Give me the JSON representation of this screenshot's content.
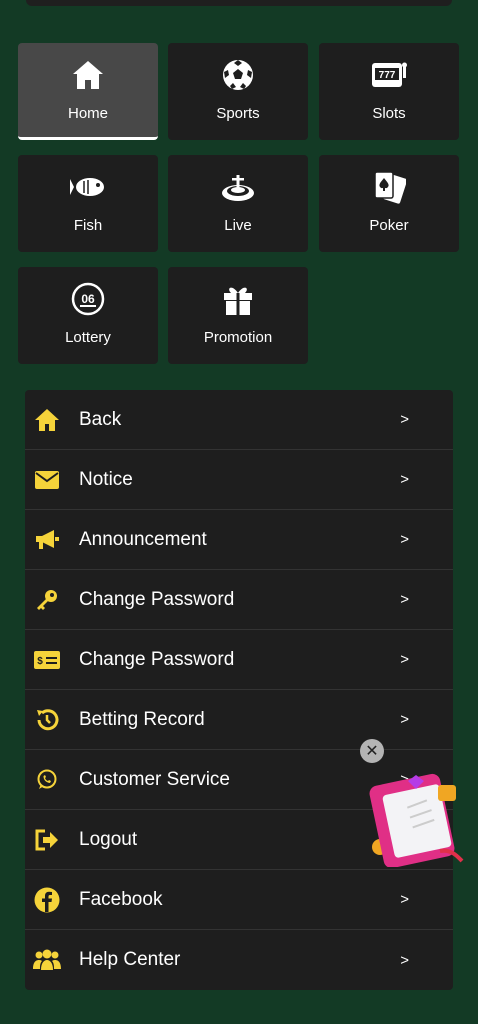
{
  "grid": [
    {
      "label": "Home",
      "icon": "home-icon",
      "active": true
    },
    {
      "label": "Sports",
      "icon": "soccer-ball-icon",
      "active": false
    },
    {
      "label": "Slots",
      "icon": "slot-machine-icon",
      "active": false
    },
    {
      "label": "Fish",
      "icon": "fish-icon",
      "active": false
    },
    {
      "label": "Live",
      "icon": "roulette-icon",
      "active": false
    },
    {
      "label": "Poker",
      "icon": "playing-cards-icon",
      "active": false
    },
    {
      "label": "Lottery",
      "icon": "lottery-ball-icon",
      "active": false
    },
    {
      "label": "Promotion",
      "icon": "gift-icon",
      "active": false
    }
  ],
  "slots_glyph": "777",
  "lottery_glyph": "06",
  "menu": [
    {
      "label": "Back",
      "icon": "home-icon",
      "arrow": ">"
    },
    {
      "label": "Notice",
      "icon": "envelope-icon",
      "arrow": ">"
    },
    {
      "label": "Announcement",
      "icon": "megaphone-icon",
      "arrow": ">"
    },
    {
      "label": "Change Password",
      "icon": "key-icon",
      "arrow": ">"
    },
    {
      "label": "Change Password",
      "icon": "card-icon",
      "arrow": ">"
    },
    {
      "label": "Betting Record",
      "icon": "history-icon",
      "arrow": ">"
    },
    {
      "label": "Customer Service",
      "icon": "whatsapp-icon",
      "arrow": ">"
    },
    {
      "label": "Logout",
      "icon": "logout-icon",
      "arrow": ">"
    },
    {
      "label": "Facebook",
      "icon": "facebook-icon",
      "arrow": ">"
    },
    {
      "label": "Help Center",
      "icon": "group-icon",
      "arrow": ">"
    }
  ],
  "floating_close": "✕",
  "colors": {
    "background": "#133a25",
    "tile": "#1e1e1e",
    "active_tile": "#484848",
    "accent": "#f5d33a"
  }
}
